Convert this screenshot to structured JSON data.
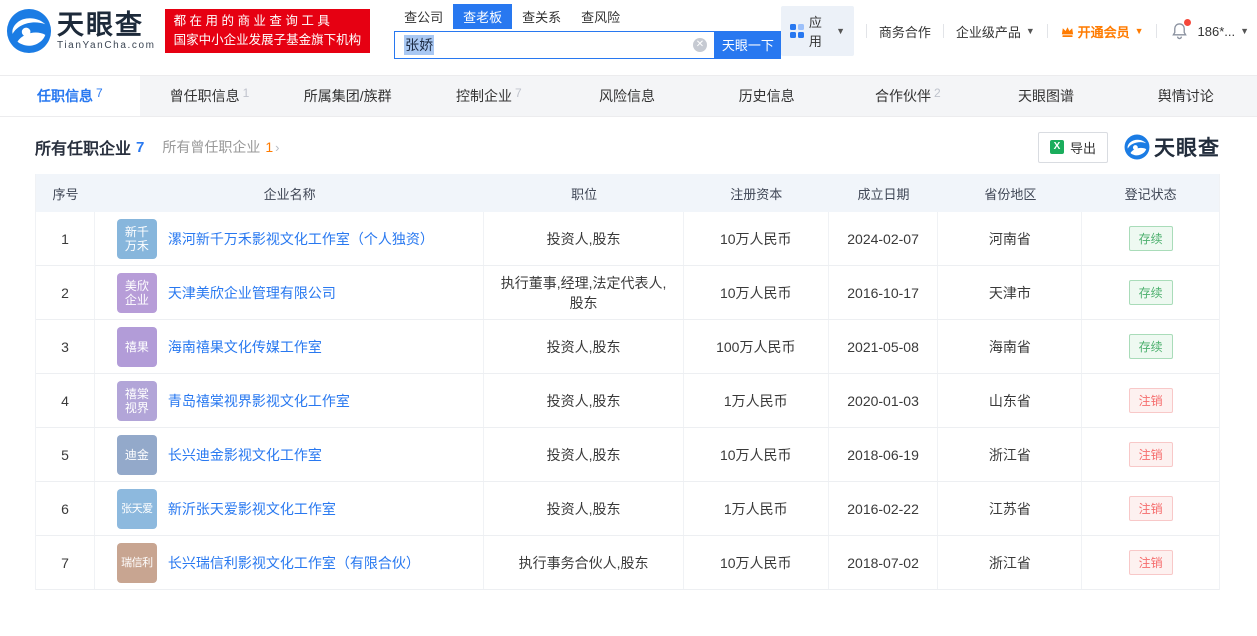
{
  "colors": {
    "accent_blue": "#2878f0",
    "promo_red": "#e60012",
    "vip_orange": "#ff7b00",
    "status_active_green": "#4db06e",
    "status_cancelled_red": "#f56c6c"
  },
  "header": {
    "logo": {
      "brand": "天眼查",
      "domain": "TianYanCha.com"
    },
    "promo": {
      "line1": "都 在 用 的 商 业 查 询 工 具",
      "line2": "国家中小企业发展子基金旗下机构"
    },
    "search": {
      "tabs": [
        {
          "label": "查公司",
          "active": false
        },
        {
          "label": "查老板",
          "active": true
        },
        {
          "label": "查关系",
          "active": false
        },
        {
          "label": "查风险",
          "active": false
        }
      ],
      "query": "张娇",
      "button": "天眼一下"
    },
    "menu": {
      "apps": "应用",
      "cooperation": "商务合作",
      "enterprise": "企业级产品",
      "vip": "开通会员",
      "phone": "186*..."
    }
  },
  "nav": {
    "tabs": [
      {
        "label": "任职信息",
        "count": "7",
        "active": true
      },
      {
        "label": "曾任职信息",
        "count": "1",
        "active": false
      },
      {
        "label": "所属集团/族群",
        "count": "",
        "active": false
      },
      {
        "label": "控制企业",
        "count": "7",
        "active": false
      },
      {
        "label": "风险信息",
        "count": "",
        "active": false
      },
      {
        "label": "历史信息",
        "count": "",
        "active": false
      },
      {
        "label": "合作伙伴",
        "count": "2",
        "active": false
      },
      {
        "label": "天眼图谱",
        "count": "",
        "active": false
      },
      {
        "label": "舆情讨论",
        "count": "",
        "active": false
      }
    ]
  },
  "section": {
    "title": "所有任职企业",
    "title_count": "7",
    "subtitle": "所有曾任职企业",
    "subtitle_count": "1",
    "chevron": "›",
    "export_label": "导出",
    "watermark_brand": "天眼查"
  },
  "table": {
    "headers": [
      "序号",
      "企业名称",
      "职位",
      "注册资本",
      "成立日期",
      "省份地区",
      "登记状态"
    ],
    "rows": [
      {
        "no": "1",
        "logo_lines": [
          "新千",
          "万禾"
        ],
        "logo_color": "#87b6dc",
        "company": "漯河新千万禾影视文化工作室（个人独资）",
        "position": "投资人,股东",
        "capital": "10万人民币",
        "date": "2024-02-07",
        "province": "河南省",
        "status": "存续",
        "status_type": "active"
      },
      {
        "no": "2",
        "logo_lines": [
          "美欣",
          "企业"
        ],
        "logo_color": "#b79dd8",
        "company": "天津美欣企业管理有限公司",
        "position": "执行董事,经理,法定代表人,股东",
        "capital": "10万人民币",
        "date": "2016-10-17",
        "province": "天津市",
        "status": "存续",
        "status_type": "active"
      },
      {
        "no": "3",
        "logo_lines": [
          "禧果"
        ],
        "logo_color": "#b29cd8",
        "company": "海南禧果文化传媒工作室",
        "position": "投资人,股东",
        "capital": "100万人民币",
        "date": "2021-05-08",
        "province": "海南省",
        "status": "存续",
        "status_type": "active"
      },
      {
        "no": "4",
        "logo_lines": [
          "禧棠",
          "视界"
        ],
        "logo_color": "#b2a5d8",
        "company": "青岛禧棠视界影视文化工作室",
        "position": "投资人,股东",
        "capital": "1万人民币",
        "date": "2020-01-03",
        "province": "山东省",
        "status": "注销",
        "status_type": "cancelled"
      },
      {
        "no": "5",
        "logo_lines": [
          "迪金"
        ],
        "logo_color": "#93a9ca",
        "company": "长兴迪金影视文化工作室",
        "position": "投资人,股东",
        "capital": "10万人民币",
        "date": "2018-06-19",
        "province": "浙江省",
        "status": "注销",
        "status_type": "cancelled"
      },
      {
        "no": "6",
        "logo_lines": [
          "张天爱"
        ],
        "logo_color": "#8db9de",
        "company": "新沂张天爱影视文化工作室",
        "position": "投资人,股东",
        "capital": "1万人民币",
        "date": "2016-02-22",
        "province": "江苏省",
        "status": "注销",
        "status_type": "cancelled"
      },
      {
        "no": "7",
        "logo_lines": [
          "瑞信利"
        ],
        "logo_color": "#c8a591",
        "company": "长兴瑞信利影视文化工作室（有限合伙）",
        "position": "执行事务合伙人,股东",
        "capital": "10万人民币",
        "date": "2018-07-02",
        "province": "浙江省",
        "status": "注销",
        "status_type": "cancelled"
      }
    ]
  }
}
